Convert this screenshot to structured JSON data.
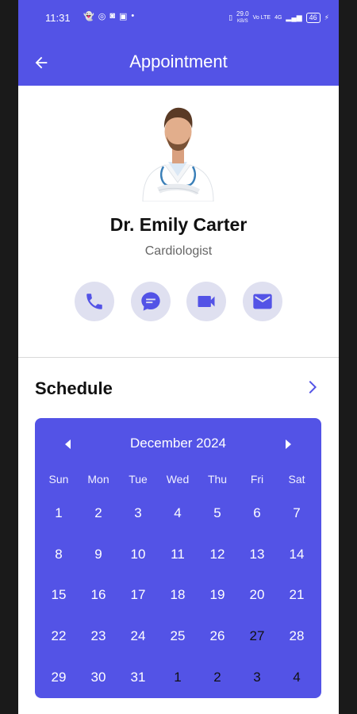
{
  "status_bar": {
    "time": "11:31",
    "network_speed_value": "29.0",
    "network_speed_unit": "KB/S",
    "network_label": "Vo LTE",
    "signal_label": "4G",
    "battery": "46"
  },
  "app_bar": {
    "title": "Appointment"
  },
  "doctor": {
    "name": "Dr. Emily Carter",
    "specialty": "Cardiologist"
  },
  "actions": [
    {
      "icon": "phone-icon"
    },
    {
      "icon": "chat-icon"
    },
    {
      "icon": "video-icon"
    },
    {
      "icon": "mail-icon"
    }
  ],
  "schedule": {
    "title": "Schedule",
    "calendar": {
      "month_title": "December 2024",
      "weekdays": [
        "Sun",
        "Mon",
        "Tue",
        "Wed",
        "Thu",
        "Fri",
        "Sat"
      ],
      "weeks": [
        [
          "1",
          "2",
          "3",
          "4",
          "5",
          "6",
          "7"
        ],
        [
          "8",
          "9",
          "10",
          "11",
          "12",
          "13",
          "14"
        ],
        [
          "15",
          "16",
          "17",
          "18",
          "19",
          "20",
          "21"
        ],
        [
          "22",
          "23",
          "24",
          "25",
          "26",
          "27",
          "28"
        ],
        [
          "29",
          "30",
          "31",
          "1",
          "2",
          "3",
          "4"
        ]
      ],
      "dark_day_cells": [
        "4-3",
        "4-4",
        "4-5",
        "4-6",
        "3-5"
      ]
    }
  },
  "colors": {
    "primary": "#5353e6",
    "action_bg": "#dfe0f0"
  }
}
